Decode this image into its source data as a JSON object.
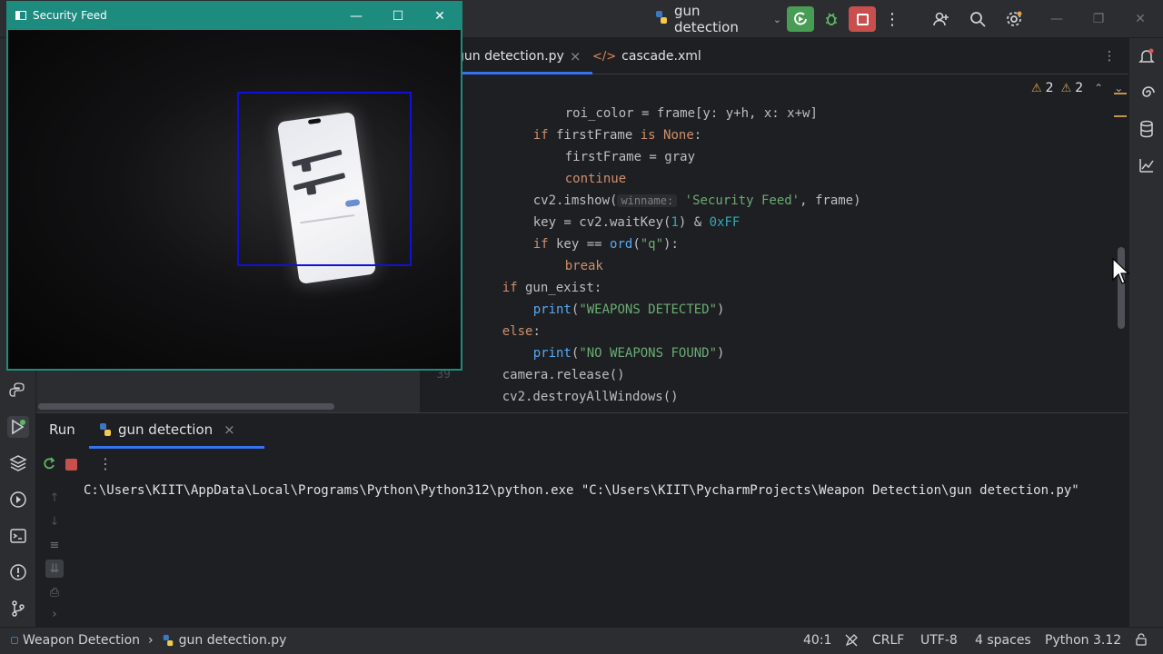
{
  "titlebar": {
    "run_config": "gun detection",
    "icons": [
      "python-icon",
      "chevron-down-icon",
      "rerun-icon",
      "debug-icon",
      "stop-icon",
      "more-icon",
      "add-user-icon",
      "search-icon",
      "settings-icon",
      "minimize-icon",
      "maximize-icon",
      "close-icon"
    ]
  },
  "editor": {
    "tabs": [
      {
        "label": "gun detection.py",
        "close": "×"
      },
      {
        "label": "cascade.xml"
      }
    ],
    "more": "⋮",
    "warnings": {
      "warn1": "2",
      "warn2": "2"
    },
    "last_line_number": "39",
    "lines": [
      {
        "id": "l1",
        "text": "roi_color = frame[y: y+h, x: x+w]"
      },
      {
        "id": "l2",
        "kw": "if",
        "rest": " firstFrame ",
        "kw2": "is",
        "kw3": "None",
        "end": ":"
      },
      {
        "id": "l3",
        "text": "firstFrame = gray"
      },
      {
        "id": "l4",
        "kw": "continue"
      },
      {
        "id": "l5",
        "pre": "cv2.imshow(",
        "hint": "winname:",
        "str": "'Security Feed'",
        "end": ", frame)"
      },
      {
        "id": "l6",
        "pre": "key = cv2.waitKey(",
        "num1": "1",
        "mid": ") & ",
        "num2": "0xFF"
      },
      {
        "id": "l7",
        "kw": "if",
        "mid": " key == ",
        "fn": "ord",
        "open": "(",
        "str": "\"q\"",
        "end": "):"
      },
      {
        "id": "l8",
        "kw": "break"
      },
      {
        "id": "l9",
        "kw": "if",
        "rest": " gun_exist:"
      },
      {
        "id": "l10",
        "fn": "print",
        "open": "(",
        "str": "\"WEAPONS DETECTED\"",
        "end": ")"
      },
      {
        "id": "l11",
        "kw": "else",
        "end": ":"
      },
      {
        "id": "l12",
        "fn": "print",
        "open": "(",
        "str": "\"NO WEAPONS FOUND\"",
        "end": ")"
      },
      {
        "id": "l13",
        "text": "camera.release()"
      },
      {
        "id": "l14",
        "text": "cv2.destroyAllWindows()"
      }
    ]
  },
  "feed_window": {
    "title": "Security Feed",
    "minimize": "—",
    "maximize": "☐",
    "close": "✕"
  },
  "run_panel": {
    "label": "Run",
    "tab": "gun detection",
    "tab_close": "×",
    "more": "⋮",
    "console_output": "C:\\Users\\KIIT\\AppData\\Local\\Programs\\Python\\Python312\\python.exe \"C:\\Users\\KIIT\\PycharmProjects\\Weapon Detection\\gun detection.py\""
  },
  "statusbar": {
    "project": "Weapon Detection",
    "separator": "›",
    "file": "gun detection.py",
    "position": "40:1",
    "line_sep": "CRLF",
    "encoding": "UTF-8",
    "indent": "4 spaces",
    "interpreter": "Python 3.12"
  },
  "colors": {
    "background": "#1e1f22",
    "panel": "#2b2d30",
    "run_green": "#499c54",
    "stop_red": "#c94f4f",
    "feed_title_teal": "#1d8c7e",
    "detection_box": "#1010d8",
    "keyword": "#cf8e6d",
    "string": "#6aab73",
    "number": "#2aacb8",
    "function": "#56a8f5"
  }
}
